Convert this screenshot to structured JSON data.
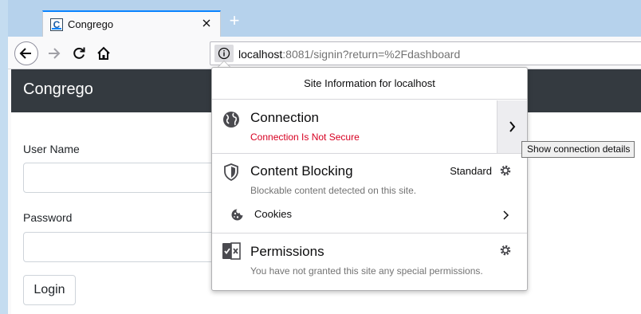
{
  "tab": {
    "title": "Congrego",
    "favicon_letter": "C",
    "close_icon": "close-icon",
    "new_tab_label": "+"
  },
  "toolbar": {
    "back_icon": "arrow-left-icon",
    "forward_icon": "arrow-right-icon",
    "reload_icon": "reload-icon",
    "home_icon": "home-icon",
    "identity_icon": "info-icon",
    "url_host": "localhost",
    "url_rest": ":8081/signin?return=%2Fdashboard"
  },
  "page": {
    "brand": "Congrego",
    "username_label": "User Name",
    "password_label": "Password",
    "login_label": "Login"
  },
  "panel": {
    "header": "Site Information for localhost",
    "connection": {
      "title": "Connection",
      "status": "Connection Is Not Secure",
      "icon": "globe-icon",
      "expand_icon": "chevron-right-icon"
    },
    "blocking": {
      "title": "Content Blocking",
      "mode": "Standard",
      "detail": "Blockable content detected on this site.",
      "icon": "shield-icon",
      "settings_icon": "gear-icon"
    },
    "cookies": {
      "label": "Cookies",
      "icon": "cookie-icon",
      "arrow_icon": "chevron-right-icon"
    },
    "permissions": {
      "title": "Permissions",
      "detail": "You have not granted this site any special permissions.",
      "icon": "permissions-icon",
      "settings_icon": "gear-icon"
    }
  },
  "tooltip": "Show connection details",
  "colors": {
    "accent": "#0a84ff",
    "insecure": "#d70022",
    "header_bg": "#343a40"
  }
}
